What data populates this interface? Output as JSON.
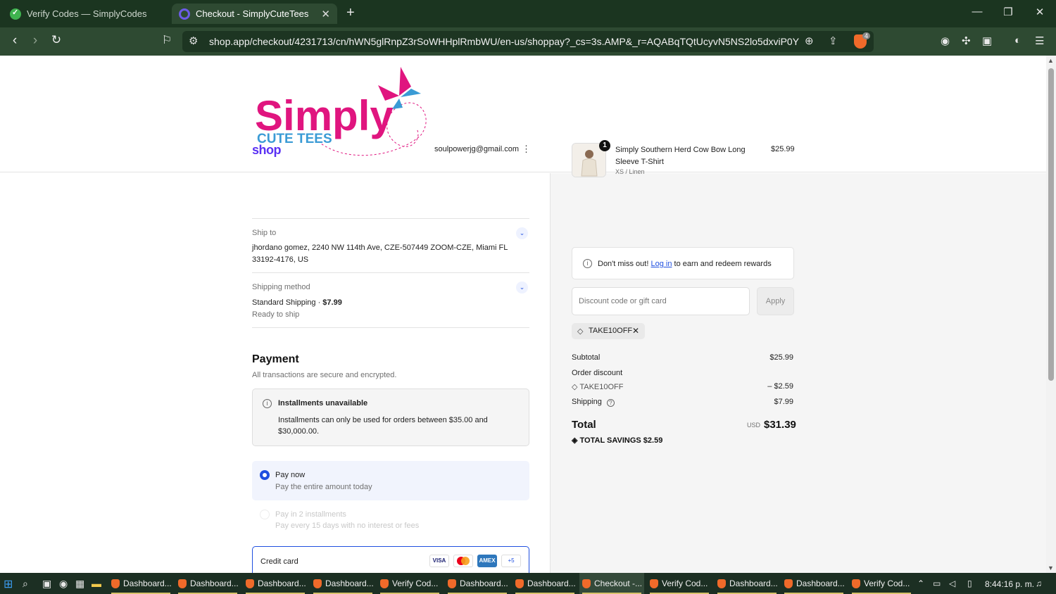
{
  "browser": {
    "tabs": [
      {
        "title": "Verify Codes — SimplyCodes"
      },
      {
        "title": "Checkout - SimplyCuteTees"
      }
    ],
    "url": "shop.app/checkout/4231713/cn/hWN5glRnpZ3rSoWHHplRmbWU/en-us/shoppay?_cs=3s.AMP&_r=AQABqTQtUcyvN5NS2lo5dxviP0YLC...",
    "brave_badge": "4"
  },
  "store": {
    "logo_text_main": "Simply",
    "logo_text_sub": "CUTE TEES"
  },
  "contact": {
    "shop_logo": "shop",
    "email": "soulpowerjg@gmail.com"
  },
  "ship_to": {
    "label": "Ship to",
    "address_line1": "jhordano gomez, 2240 NW 114th Ave, CZE-507449 ZOOM-CZE, Miami FL",
    "address_line2": "33192-4176, US"
  },
  "shipping_method": {
    "label": "Shipping method",
    "name": "Standard Shipping · ",
    "price": "$7.99",
    "status": "Ready to ship"
  },
  "payment": {
    "title": "Payment",
    "subtitle": "All transactions are secure and encrypted.",
    "notice_title": "Installments unavailable",
    "notice_body": "Installments can only be used for orders between $35.00 and $30,000.00.",
    "options": [
      {
        "title": "Pay now",
        "subtitle": "Pay the entire amount today",
        "selected": true
      },
      {
        "title": "Pay in 2 installments",
        "subtitle": "Pay every 15 days with no interest or fees",
        "selected": false
      }
    ],
    "credit_card_label": "Credit card",
    "card_brands": [
      "VISA",
      "",
      "AMEX",
      "+5"
    ]
  },
  "order": {
    "item": {
      "quantity": "1",
      "name": "Simply Southern Herd Cow Bow Long Sleeve T-Shirt",
      "variant": "XS / Linen",
      "price": "$25.99"
    },
    "rewards": {
      "prefix": "Don't miss out! ",
      "link": "Log in",
      "suffix": " to earn and redeem rewards"
    },
    "discount_placeholder": "Discount code or gift card",
    "apply_label": "Apply",
    "applied_code": "TAKE10OFF",
    "subtotal_label": "Subtotal",
    "subtotal": "$25.99",
    "order_discount_label": "Order discount",
    "discount_code": "TAKE10OFF",
    "discount_value": "– $2.59",
    "shipping_label": "Shipping",
    "shipping": "$7.99",
    "total_label": "Total",
    "currency": "USD",
    "total": "$31.39",
    "savings_label": "TOTAL SAVINGS",
    "savings": "$2.59"
  },
  "taskbar": {
    "items": [
      "Dashboard...",
      "Dashboard...",
      "Dashboard...",
      "Dashboard...",
      "Verify Cod...",
      "Dashboard...",
      "Dashboard...",
      "Checkout -...",
      "Verify Cod...",
      "Dashboard...",
      "Dashboard...",
      "Verify Cod..."
    ],
    "clock": "8:44:16 p. m."
  },
  "colors": {
    "accent": "#1f4fe0",
    "shop_purple": "#5a31f4",
    "logo_pink": "#e0157f",
    "logo_blue": "#3a9bd5"
  }
}
